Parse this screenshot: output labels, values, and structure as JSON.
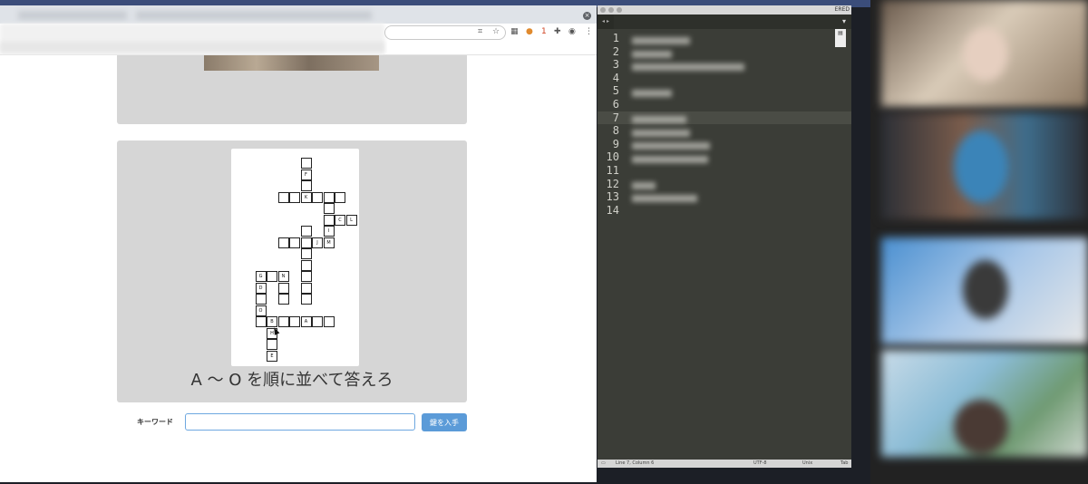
{
  "browser": {
    "toolbar_icons": [
      "qr-icon",
      "star-icon",
      "extension-icon",
      "profile-icon",
      "menu-icon"
    ],
    "notification_count": "1",
    "puzzle": {
      "letters": [
        "F",
        "K",
        "C",
        "L",
        "I",
        "J",
        "M",
        "G",
        "N",
        "D",
        "O",
        "B",
        "A",
        "H",
        "E"
      ]
    },
    "question": "A 〜 O を順に並べて答えろ",
    "keyword": {
      "label": "キーワード",
      "value": "",
      "placeholder": "",
      "button_label": "鍵を入手"
    }
  },
  "editor": {
    "title": "ERED",
    "line_numbers": [
      "1",
      "2",
      "3",
      "4",
      "5",
      "6",
      "7",
      "8",
      "9",
      "10",
      "11",
      "12",
      "13",
      "14"
    ],
    "active_line": 7,
    "status": {
      "position": "Line 7, Column 6",
      "encoding": "UTF-8",
      "line_endings": "Unix",
      "indent": "Tab"
    }
  },
  "colors": {
    "button_blue": "#5b9bd8",
    "editor_bg": "#3b3d37",
    "card_gray": "#d6d6d6"
  }
}
